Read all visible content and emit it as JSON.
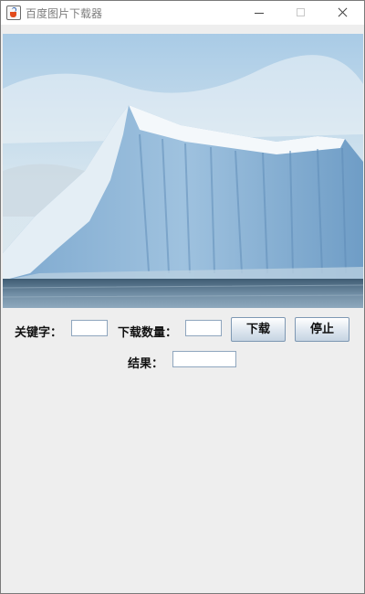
{
  "window": {
    "title": "百度图片下载器",
    "app_icon": "java-cup-icon",
    "controls": [
      "minimize-icon",
      "maximize-icon",
      "close-icon"
    ]
  },
  "banner_image": {
    "subject": "iceberg-photo"
  },
  "form": {
    "keyword_label": "关键字：",
    "keyword_value": "",
    "count_label": "下载数量：",
    "count_value": "",
    "download_button": "下载",
    "stop_button": "停止",
    "result_label": "结果：",
    "result_value": ""
  },
  "colors": {
    "window_background": "#eeeeee",
    "title_text": "#7d7d7d",
    "button_border": "#7e98b3"
  }
}
